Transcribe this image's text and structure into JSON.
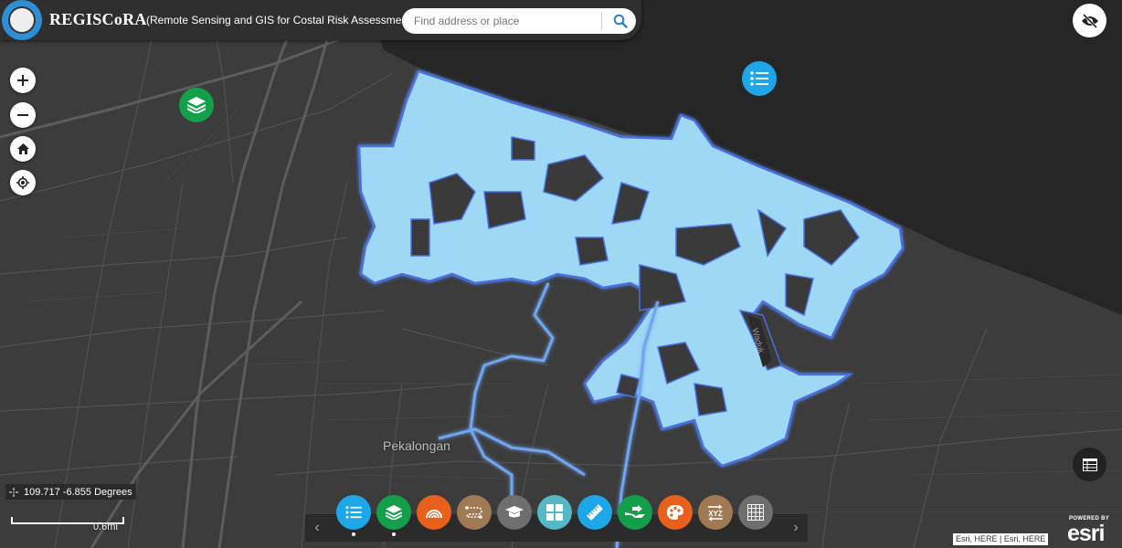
{
  "header": {
    "app_title": "REGISCoRA",
    "subtitle": "(Remote Sensing and GIS for Costal Risk Assessment)",
    "logo_icon": "university-seal-icon"
  },
  "search": {
    "placeholder": "Find address or place",
    "value": "",
    "button_icon": "search-icon"
  },
  "map_controls": {
    "zoom_in_icon": "plus-icon",
    "zoom_out_icon": "minus-icon",
    "home_icon": "home-icon",
    "locate_icon": "locate-icon",
    "hide_ui_icon": "eye-slash-icon",
    "layers_icon": "layers-icon",
    "legend_icon": "list-icon",
    "attribute_table_icon": "table-icon"
  },
  "map_labels": {
    "city": "Pekalongan",
    "reservoir": "Waduk"
  },
  "coordinates": {
    "text": "109.717 -6.855 Degrees"
  },
  "scale": {
    "label": "0.6mi"
  },
  "toolbar": {
    "prev": "‹",
    "next": "›",
    "tools": [
      {
        "name": "legend",
        "icon": "list-icon",
        "color": "#1ea7e8",
        "active": true
      },
      {
        "name": "layer-list",
        "icon": "layers-icon",
        "color": "#14a04a",
        "active": true
      },
      {
        "name": "basemap-gallery",
        "icon": "rainbow-icon",
        "color": "#e8601c",
        "active": false
      },
      {
        "name": "directions",
        "icon": "route-icon",
        "color": "#a07a54",
        "active": false
      },
      {
        "name": "about",
        "icon": "graduation-cap-icon",
        "color": "#6e6e6e",
        "active": false
      },
      {
        "name": "dashboard",
        "icon": "grid-icon",
        "color": "#56b8c4",
        "active": false
      },
      {
        "name": "measurement",
        "icon": "ruler-icon",
        "color": "#1ea7e8",
        "active": false
      },
      {
        "name": "share",
        "icon": "share-icon",
        "color": "#14a04a",
        "active": false
      },
      {
        "name": "draw",
        "icon": "palette-icon",
        "color": "#e8601c",
        "active": false
      },
      {
        "name": "coordinate-conversion",
        "icon": "xyz-icon",
        "color": "#a07a54",
        "active": false
      },
      {
        "name": "grid",
        "icon": "table-grid-icon",
        "color": "#6e6e6e",
        "active": false
      }
    ]
  },
  "attribution": "Esri, HERE | Esri, HERE",
  "esri_logo": {
    "powered_by": "POWERED BY",
    "word": "esri"
  },
  "colors": {
    "flood": "#9fd8f5",
    "flood_edge": "#4a6fe0",
    "water": "#262626",
    "land": "#3c3c3c"
  }
}
